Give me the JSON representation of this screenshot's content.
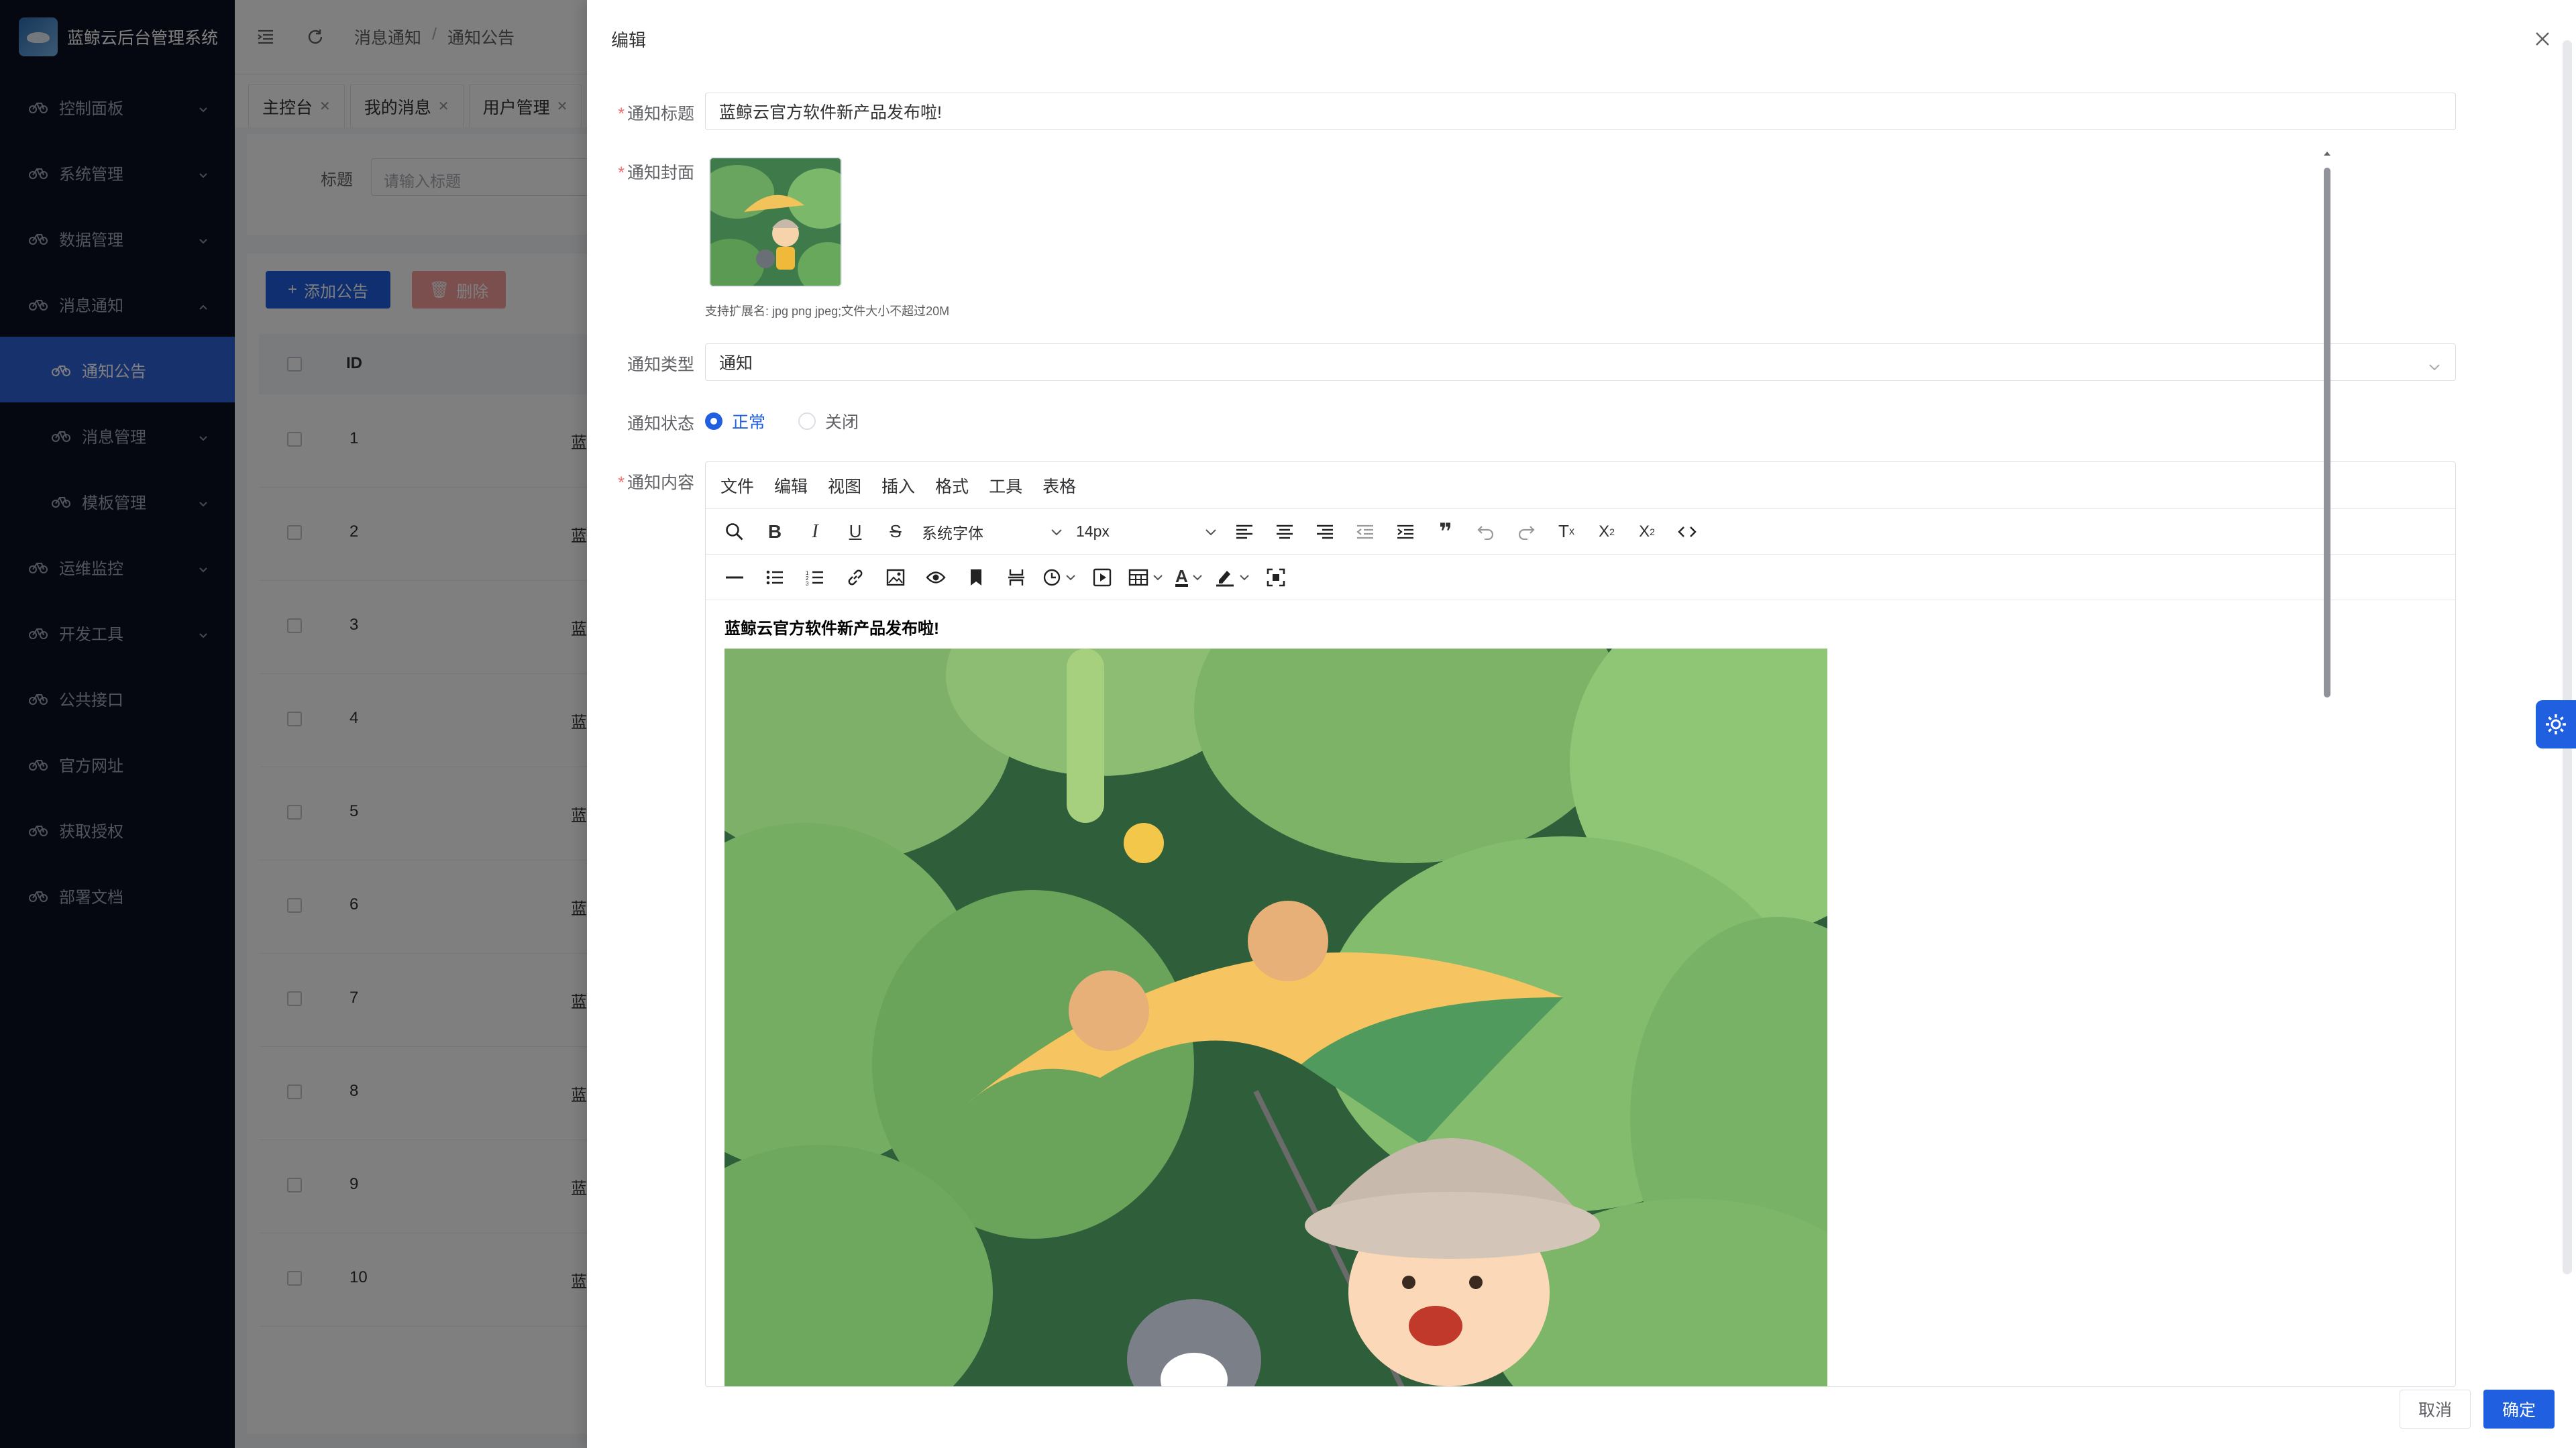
{
  "app": {
    "title": "蓝鲸云后台管理系统"
  },
  "sidebar": {
    "items": [
      {
        "label": "控制面板"
      },
      {
        "label": "系统管理"
      },
      {
        "label": "数据管理"
      },
      {
        "label": "消息通知"
      },
      {
        "label": "通知公告"
      },
      {
        "label": "消息管理"
      },
      {
        "label": "模板管理"
      },
      {
        "label": "运维监控"
      },
      {
        "label": "开发工具"
      },
      {
        "label": "公共接口"
      },
      {
        "label": "官方网址"
      },
      {
        "label": "获取授权"
      },
      {
        "label": "部署文档"
      }
    ]
  },
  "breadcrumb": {
    "parent": "消息通知",
    "sep": "/",
    "current": "通知公告"
  },
  "tabs": [
    {
      "label": "主控台"
    },
    {
      "label": "我的消息"
    },
    {
      "label": "用户管理"
    }
  ],
  "search": {
    "label": "标题",
    "placeholder": "请输入标题"
  },
  "actions": {
    "add": "添加公告",
    "delete": "删除"
  },
  "table": {
    "id_header": "ID",
    "rows": [
      {
        "id": "1",
        "title": "蓝鲸云"
      },
      {
        "id": "2",
        "title": "蓝鲸云"
      },
      {
        "id": "3",
        "title": "蓝鲸云"
      },
      {
        "id": "4",
        "title": "蓝鲸云"
      },
      {
        "id": "5",
        "title": "蓝鲸云"
      },
      {
        "id": "6",
        "title": "蓝鲸云"
      },
      {
        "id": "7",
        "title": "蓝鲸云"
      },
      {
        "id": "8",
        "title": "蓝鲸云"
      },
      {
        "id": "9",
        "title": "蓝鲸云"
      },
      {
        "id": "10",
        "title": "蓝鲸云"
      }
    ]
  },
  "drawer": {
    "title": "编辑",
    "fields": {
      "title_label": "通知标题",
      "title_value": "蓝鲸云官方软件新产品发布啦!",
      "cover_label": "通知封面",
      "cover_hint": "支持扩展名: jpg png jpeg;文件大小不超过20M",
      "type_label": "通知类型",
      "type_value": "通知",
      "status_label": "通知状态",
      "status_normal": "正常",
      "status_closed": "关闭",
      "content_label": "通知内容"
    },
    "editor": {
      "menus": [
        "文件",
        "编辑",
        "视图",
        "插入",
        "格式",
        "工具",
        "表格"
      ],
      "font_family": "系统字体",
      "font_size": "14px",
      "content_title": "蓝鲸云官方软件新产品发布啦!"
    },
    "cancel": "取消",
    "ok": "确定"
  },
  "colors": {
    "primary": "#1f5fe0",
    "sidebar": "#0b1120",
    "danger": "#f56c6c"
  }
}
